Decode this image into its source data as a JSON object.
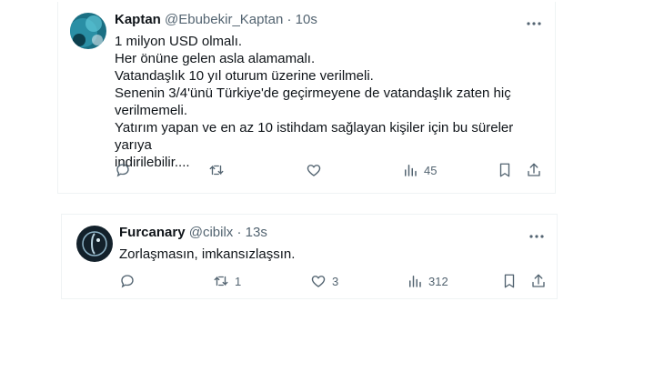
{
  "tweets": [
    {
      "name": "Kaptan",
      "handle": "@Ebubekir_Kaptan",
      "separator": "·",
      "time": "10s",
      "lines": [
        "1 milyon USD olmalı.",
        "Her önüne gelen asla alamamalı.",
        "Vatandaşlık 10 yıl oturum üzerine verilmeli.",
        "Senenin 3/4'ünü Türkiye'de geçirmeyene de vatandaşlık zaten hiç",
        "verilmemeli.",
        "Yatırım yapan ve en az 10 istihdam sağlayan kişiler için bu süreler yarıya",
        "indirilebilir...."
      ],
      "actions": {
        "replies": "",
        "retweets": "",
        "likes": "",
        "views": "45"
      },
      "avatar_colors": {
        "bg": "#1a6f83",
        "accent": "#5fc7d8"
      }
    },
    {
      "name": "Furcanary",
      "handle": "@cibilx",
      "separator": "·",
      "time": "13s",
      "lines": [
        "Zorlaşmasın, imkansızlaşsın."
      ],
      "actions": {
        "replies": "",
        "retweets": "1",
        "likes": "3",
        "views": "312"
      },
      "avatar_colors": {
        "bg": "#13212b",
        "accent": "#8fb5c9"
      }
    }
  ],
  "icons": {
    "more": "more-dots-icon",
    "reply": "reply-icon",
    "retweet": "retweet-icon",
    "like": "heart-icon",
    "views": "views-chart-icon",
    "bookmark": "bookmark-icon",
    "share": "share-icon"
  },
  "colors": {
    "text": "#0f1419",
    "secondary": "#536471",
    "border": "#eff3f4"
  }
}
